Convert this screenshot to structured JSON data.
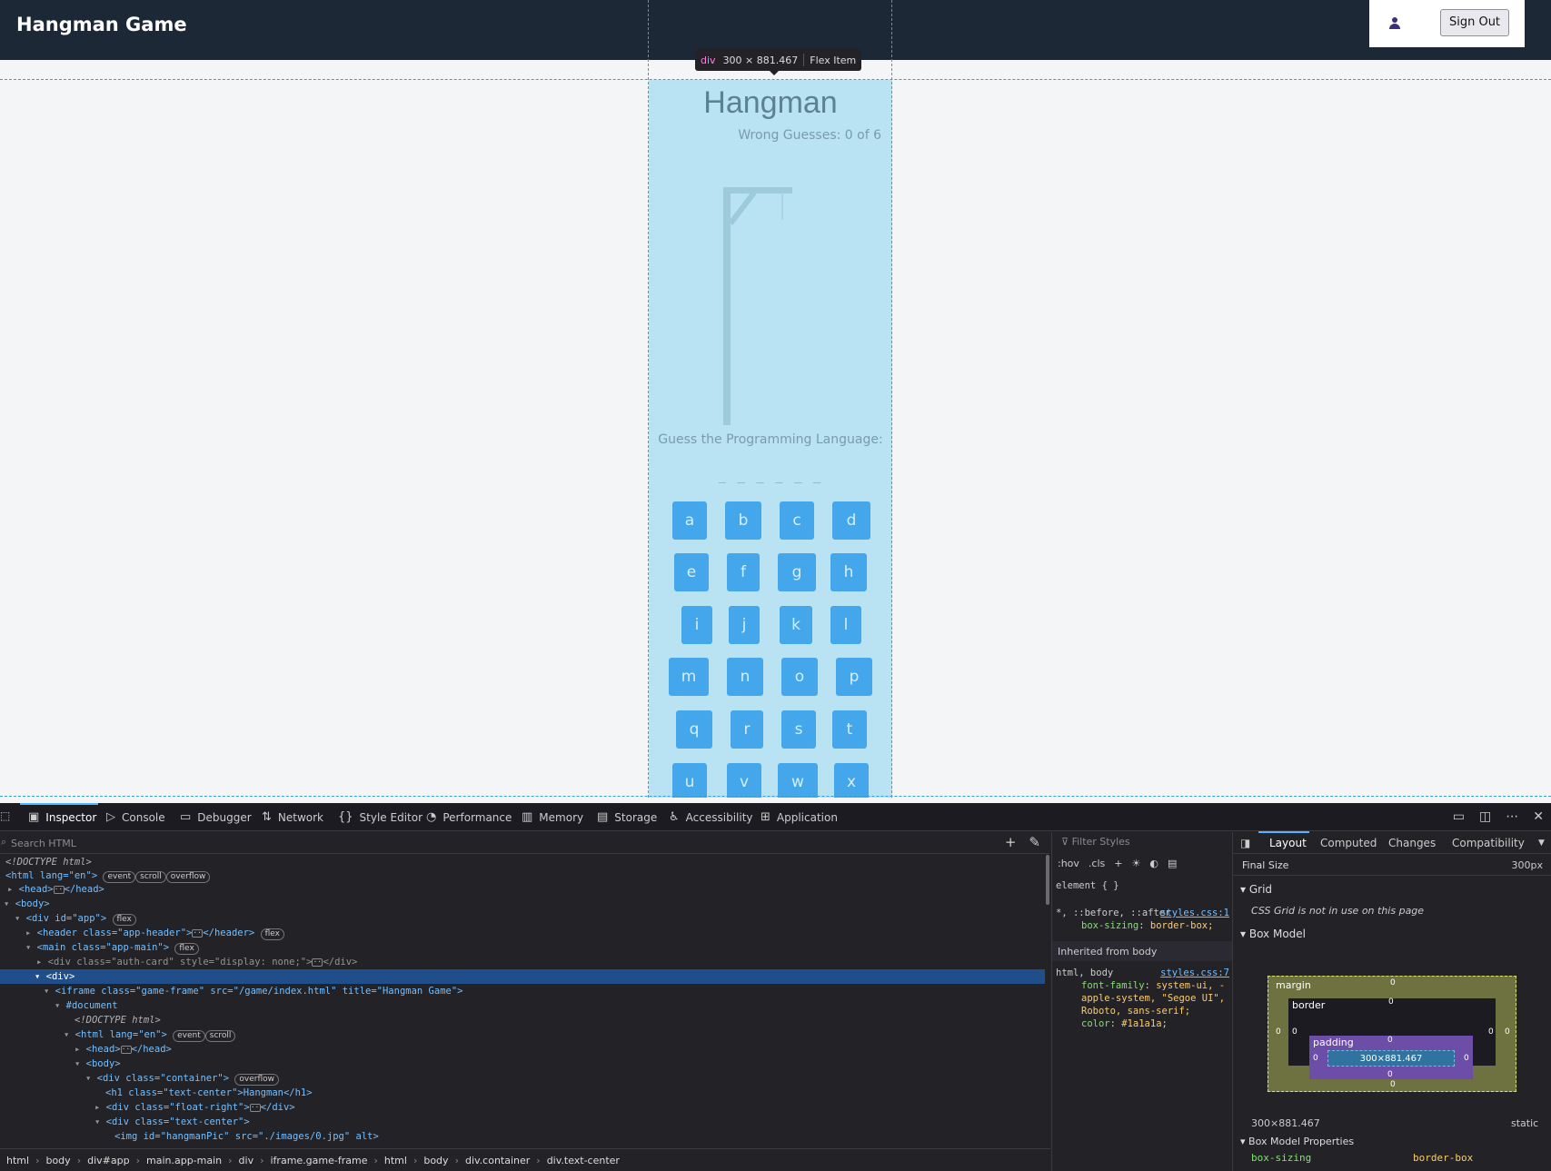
{
  "app": {
    "title": "Hangman Game",
    "user_name": "",
    "signout_label": "Sign Out"
  },
  "tooltip": {
    "tag": "div",
    "size": "300 × 881.467",
    "flex": "Flex Item"
  },
  "game": {
    "title": "Hangman",
    "wrong_guesses": "Wrong Guesses: 0 of 6",
    "prompt": "Guess the Programming Language:",
    "word": "_ _ _ _ _ _",
    "letters": [
      "a",
      "b",
      "c",
      "d",
      "e",
      "f",
      "g",
      "h",
      "i",
      "j",
      "k",
      "l",
      "m",
      "n",
      "o",
      "p",
      "q",
      "r",
      "s",
      "t",
      "u",
      "v",
      "w",
      "x"
    ]
  },
  "devtools": {
    "tabs": [
      "Inspector",
      "Console",
      "Debugger",
      "Network",
      "Style Editor",
      "Performance",
      "Memory",
      "Storage",
      "Accessibility",
      "Application"
    ],
    "search_placeholder": "Search HTML",
    "tree": {
      "doctype": "<!DOCTYPE html>",
      "html_open": "<html lang=\"en\">",
      "badge_event": "event",
      "badge_scroll": "scroll",
      "badge_overflow": "overflow",
      "badge_flex": "flex",
      "head": "<head>",
      "head_close": "</head>",
      "body": "<body>",
      "div_app": "<div id=\"app\">",
      "header": "<header class=\"app-header\">",
      "header_close": "</header>",
      "main": "<main class=\"app-main\">",
      "auth_card": "<div class=\"auth-card\" style=\"display: none;\">",
      "div_close": "</div>",
      "div": "<div>",
      "iframe": "<iframe class=\"game-frame\" src=\"/game/index.html\" title=\"Hangman Game\">",
      "document": "#document",
      "container": "<div class=\"container\">",
      "h1": "<h1 class=\"text-center\">Hangman</h1>",
      "float_right": "<div class=\"float-right\">",
      "text_center": "<div class=\"text-center\">",
      "img": "<img id=\"hangmanPic\" src=\"./images/0.jpg\" alt>"
    },
    "breadcrumb": [
      "html",
      "body",
      "div#app",
      "main.app-main",
      "div",
      "iframe.game-frame",
      "html",
      "body",
      "div.container",
      "div.text-center"
    ],
    "rules": {
      "filter_placeholder": "Filter Styles",
      "hov": ":hov",
      "cls": ".cls",
      "element_rule": "element { }",
      "universal_selector": "*, ::before, ::after",
      "universal_src": "styles.css:1",
      "box_sizing_prop": "box-sizing",
      "box_sizing_val": "border-box;",
      "inherited_label": "Inherited from body",
      "body_selector": "html, body",
      "body_src": "styles.css:7",
      "font_prop": "font-family",
      "font_val": "system-ui, -apple-system, \"Segoe UI\", Roboto, sans-serif;",
      "color_prop": "color",
      "color_val": "#1a1a1a;"
    },
    "layout": {
      "tabs": [
        "Layout",
        "Computed",
        "Changes",
        "Compatibility"
      ],
      "final_size_label": "Final Size",
      "final_size_value": "300px",
      "grid_label": "Grid",
      "grid_note": "CSS Grid is not in use on this page",
      "box_model_label": "Box Model",
      "margin_label": "margin",
      "border_label": "border",
      "padding_label": "padding",
      "content_size": "300×881.467",
      "zero": "0",
      "dimensions": "300×881.467",
      "position": "static",
      "box_props_label": "Box Model Properties",
      "box_sizing_label": "box-sizing",
      "box_sizing_value": "border-box"
    }
  }
}
